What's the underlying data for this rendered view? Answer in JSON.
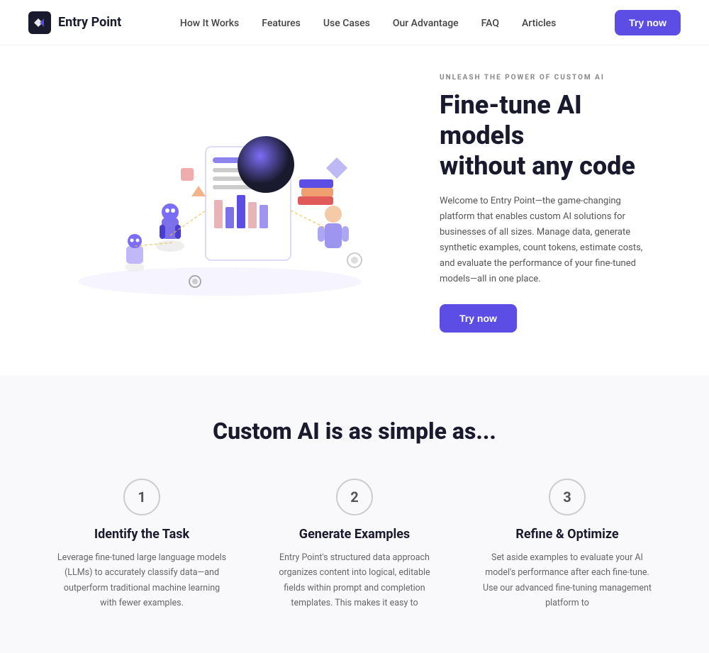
{
  "brand": {
    "name": "Entry Point"
  },
  "nav": {
    "links": [
      {
        "label": "How It Works",
        "href": "#"
      },
      {
        "label": "Features",
        "href": "#"
      },
      {
        "label": "Use Cases",
        "href": "#"
      },
      {
        "label": "Our Advantage",
        "href": "#"
      },
      {
        "label": "FAQ",
        "href": "#"
      },
      {
        "label": "Articles",
        "href": "#"
      }
    ],
    "cta_label": "Try now"
  },
  "hero": {
    "eyebrow": "UNLEASH THE POWER OF CUSTOM AI",
    "title_line1": "Fine-tune AI models",
    "title_line2": "without any code",
    "description": "Welcome to Entry Point—the game-changing platform that enables custom AI solutions for businesses of all sizes. Manage data, generate synthetic examples, count tokens, estimate costs, and evaluate the performance of your fine-tuned models—all in one place.",
    "cta_label": "Try now"
  },
  "custom_ai": {
    "section_title": "Custom AI is as simple as...",
    "steps": [
      {
        "number": "1",
        "title": "Identify the Task",
        "description": "Leverage fine-tuned large language models (LLMs) to accurately classify data—and outperform traditional machine learning with fewer examples."
      },
      {
        "number": "2",
        "title": "Generate Examples",
        "description": "Entry Point's structured data approach organizes content into logical, editable fields within prompt and completion templates. This makes it easy to"
      },
      {
        "number": "3",
        "title": "Refine & Optimize",
        "description": "Set aside examples to evaluate your AI model's performance after each fine-tune. Use our advanced fine-tuning management platform to"
      }
    ]
  },
  "colors": {
    "accent": "#5c4ee5",
    "text_primary": "#1a1a2e",
    "text_secondary": "#555",
    "text_muted": "#888"
  }
}
